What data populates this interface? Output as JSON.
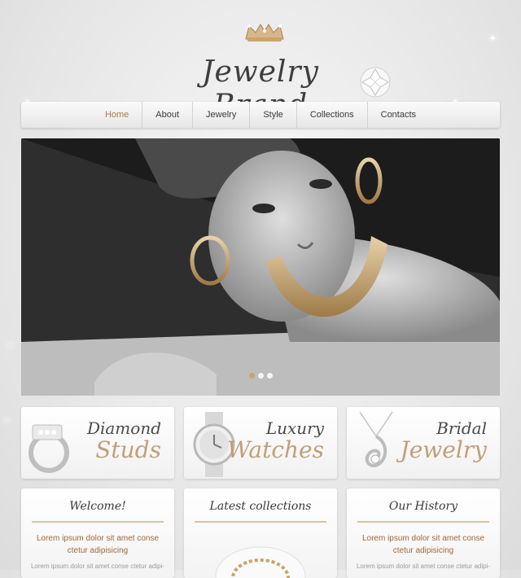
{
  "brand": {
    "name": "Jewelry Brand"
  },
  "nav": {
    "items": [
      {
        "label": "Home",
        "active": true
      },
      {
        "label": "About",
        "active": false
      },
      {
        "label": "Jewelry",
        "active": false
      },
      {
        "label": "Style",
        "active": false
      },
      {
        "label": "Collections",
        "active": false
      },
      {
        "label": "Contacts",
        "active": false
      }
    ]
  },
  "slider": {
    "slide_count": 3,
    "active_index": 1
  },
  "promos": [
    {
      "line1": "Diamond",
      "line2": "Studs"
    },
    {
      "line1": "Luxury",
      "line2": "Watches"
    },
    {
      "line1": "Bridal",
      "line2": "Jewelry"
    }
  ],
  "columns": [
    {
      "heading": "Welcome!",
      "lead": "Lorem ipsum dolor sit amet conse ctetur adipisicing",
      "body": "Lorem ipsum dolor sit amet conse ctetur adipi-"
    },
    {
      "heading": "Latest collections",
      "lead": "",
      "body": ""
    },
    {
      "heading": "Our History",
      "lead": "Lorem ipsum dolor sit amet conse ctetur adipisicing",
      "body": "Lorem ipsum dolor sit amet conse ctetur adipi-"
    }
  ],
  "colors": {
    "accent": "#b07a4e",
    "gold": "#bfa07a",
    "text": "#3a3a3a"
  }
}
